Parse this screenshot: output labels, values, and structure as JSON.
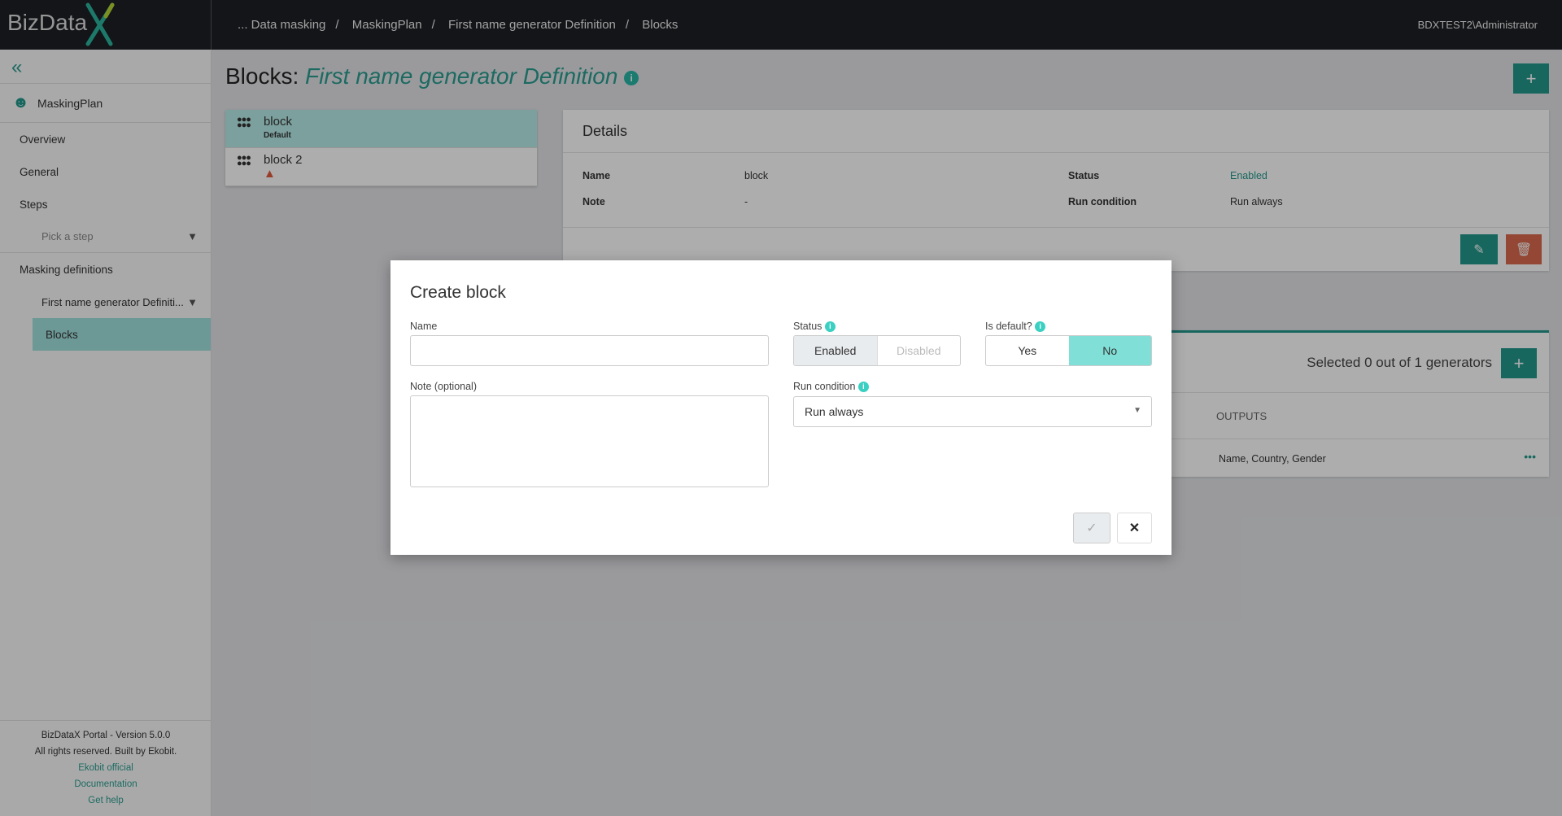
{
  "topbar": {
    "logo": "BizData",
    "logo_x": "X",
    "breadcrumbs": [
      "... Data masking",
      "MaskingPlan",
      "First name generator Definition",
      "Blocks"
    ],
    "separator": "/",
    "user": "BDXTEST2\\Administrator"
  },
  "sidebar": {
    "plan": "MaskingPlan",
    "items": [
      "Overview",
      "General",
      "Steps"
    ],
    "step_picker": "Pick a step",
    "masking_label": "Masking definitions",
    "definition": "First name generator Definiti...",
    "active": "Blocks",
    "footer": {
      "version": "BizDataX Portal - Version 5.0.0",
      "rights": "All rights reserved. Built by Ekobit.",
      "links": [
        "Ekobit official",
        "Documentation",
        "Get help"
      ]
    }
  },
  "page": {
    "title_prefix": "Blocks:",
    "title_name": "First name generator Definition",
    "blocks": [
      {
        "name": "block",
        "badge": "Default"
      },
      {
        "name": "block 2",
        "warning": true
      }
    ],
    "details": {
      "heading": "Details",
      "name_label": "Name",
      "name": "block",
      "note_label": "Note",
      "note": "-",
      "status_label": "Status",
      "status": "Enabled",
      "run_label": "Run condition",
      "run": "Run always"
    },
    "generators": {
      "selected": "Selected 0 out of 1 generators",
      "outputs_header": "OUTPUTS",
      "outputs": "Name, Country, Gender"
    }
  },
  "modal": {
    "title": "Create block",
    "name_label": "Name",
    "name_value": "",
    "note_label": "Note (optional)",
    "note_value": "",
    "status_label": "Status",
    "status_options": [
      "Enabled",
      "Disabled"
    ],
    "status_selected": "Enabled",
    "default_label": "Is default?",
    "default_options": [
      "Yes",
      "No"
    ],
    "default_selected": "No",
    "run_label": "Run condition",
    "run_value": "Run always"
  },
  "colors": {
    "accent": "#23998c",
    "danger": "#d9694d",
    "selected": "#80e0d8"
  }
}
